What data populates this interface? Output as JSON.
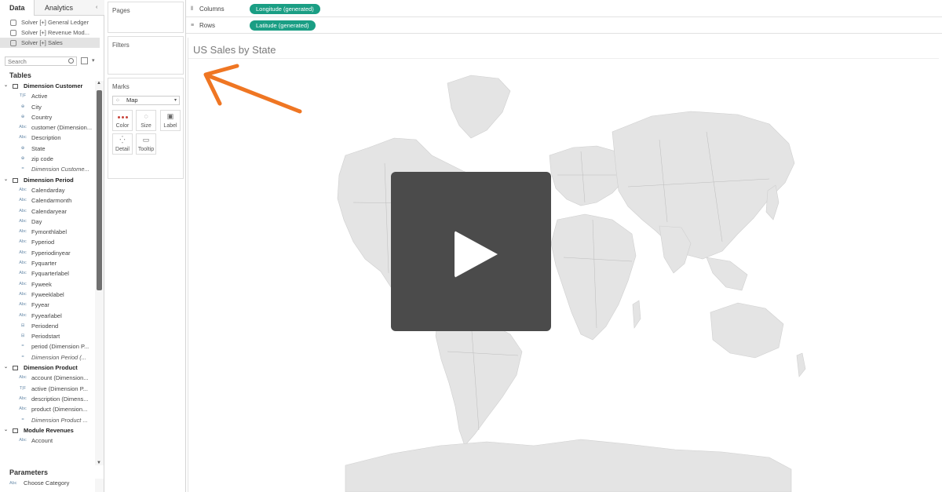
{
  "tabs": {
    "data": "Data",
    "analytics": "Analytics"
  },
  "sources": [
    {
      "label": "Solver [+] General Ledger"
    },
    {
      "label": "Solver [+] Revenue Mod..."
    },
    {
      "label": "Solver [+] Sales"
    }
  ],
  "search": {
    "placeholder": "Search"
  },
  "tables_title": "Tables",
  "groups": {
    "customer": {
      "name": "Dimension Customer",
      "fields": [
        {
          "type": "T|F",
          "label": "Active"
        },
        {
          "type": "⊕",
          "label": "City"
        },
        {
          "type": "⊕",
          "label": "Country"
        },
        {
          "type": "Abc",
          "label": "customer (Dimension..."
        },
        {
          "type": "Abc",
          "label": "Description"
        },
        {
          "type": "⊕",
          "label": "State"
        },
        {
          "type": "⊕",
          "label": "zip code"
        },
        {
          "type": "=",
          "label": "Dimension Custome..."
        }
      ]
    },
    "period": {
      "name": "Dimension Period",
      "fields": [
        {
          "type": "Abc",
          "label": "Calendarday"
        },
        {
          "type": "Abc",
          "label": "Calendarmonth"
        },
        {
          "type": "Abc",
          "label": "Calendaryear"
        },
        {
          "type": "Abc",
          "label": "Day"
        },
        {
          "type": "Abc",
          "label": "Fymonthlabel"
        },
        {
          "type": "Abc",
          "label": "Fyperiod"
        },
        {
          "type": "Abc",
          "label": "Fyperiodinyear"
        },
        {
          "type": "Abc",
          "label": "Fyquarter"
        },
        {
          "type": "Abc",
          "label": "Fyquarterlabel"
        },
        {
          "type": "Abc",
          "label": "Fyweek"
        },
        {
          "type": "Abc",
          "label": "Fyweeklabel"
        },
        {
          "type": "Abc",
          "label": "Fyyear"
        },
        {
          "type": "Abc",
          "label": "Fyyearlabel"
        },
        {
          "type": "⊟",
          "label": "Periodend"
        },
        {
          "type": "⊟",
          "label": "Periodstart"
        },
        {
          "type": "=",
          "label": "period (Dimension P..."
        },
        {
          "type": "=",
          "label": "Dimension Period (..."
        }
      ]
    },
    "product": {
      "name": "Dimension Product",
      "fields": [
        {
          "type": "Abc",
          "label": "account (Dimension..."
        },
        {
          "type": "T|F",
          "label": "active (Dimension P..."
        },
        {
          "type": "Abc",
          "label": "description (Dimens..."
        },
        {
          "type": "Abc",
          "label": "product (Dimension..."
        },
        {
          "type": "=",
          "label": "Dimension Product ..."
        }
      ]
    },
    "revenues": {
      "name": "Module Revenues",
      "fields": [
        {
          "type": "Abc",
          "label": "Account"
        }
      ]
    }
  },
  "parameters": {
    "title": "Parameters",
    "item_type": "Abc",
    "item": "Choose Category"
  },
  "cards": {
    "pages": "Pages",
    "filters": "Filters",
    "marks": "Marks",
    "mark_type": "Map",
    "color": "Color",
    "size": "Size",
    "label": "Label",
    "detail": "Detail",
    "tooltip": "Tooltip"
  },
  "shelves": {
    "columns": {
      "label": "Columns",
      "pill": "Longitude (generated)"
    },
    "rows": {
      "label": "Rows",
      "pill": "Latitude (generated)"
    }
  },
  "sheet_title": "US Sales by State",
  "colors": {
    "pill": "#1a9e84",
    "arrow": "#ef7623",
    "land": "#e4e4e4",
    "borders": "#bcbcbc",
    "play_overlay": "#4b4b4b"
  },
  "icons": {
    "search": "search-icon",
    "play": "play-icon",
    "map_mark": "map-icon"
  }
}
